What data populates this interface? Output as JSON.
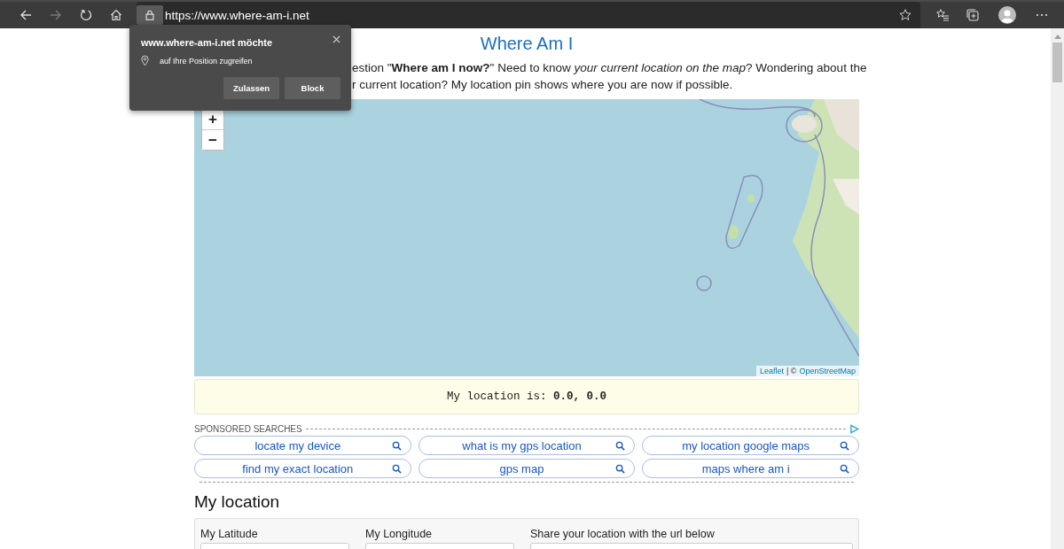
{
  "browser": {
    "url": "https://www.where-am-i.net",
    "forward_disabled": true
  },
  "permission_popup": {
    "title": "www.where-am-i.net möchte",
    "request": "auf Ihre Position zugreifen",
    "buttons": [
      "Zulassen",
      "Block"
    ]
  },
  "page": {
    "title": "Where Am I",
    "intro_lines": [
      "estion \"**Where am I now?**\" Need to know *your current location on the map*? Wondering about the",
      "r current location? My location pin shows where you are now if possible."
    ]
  },
  "map": {
    "zoom_in": "+",
    "zoom_out": "−",
    "attribution": {
      "first_link": "Leaflet",
      "separator": "| ©",
      "second_link": "OpenStreetMap"
    }
  },
  "location": {
    "text": "My location is: **0.0, 0.0**"
  },
  "sponsored": {
    "heading": "SPONSORED SEARCHES",
    "links": [
      "locate my device",
      "what is my gps location",
      "my location google maps",
      "find my exact location",
      "gps map",
      "maps where am i"
    ]
  },
  "section": {
    "title": "My location",
    "fields": [
      {
        "label": "My Latitude"
      },
      {
        "label": "My Longitude"
      },
      {
        "label": "Share your location with the url below"
      }
    ]
  }
}
